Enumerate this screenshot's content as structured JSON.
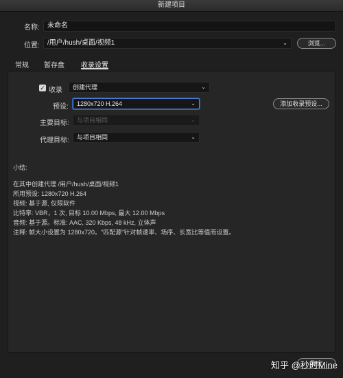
{
  "window": {
    "title": "新建项目"
  },
  "name": {
    "label": "名称:",
    "value": "未命名"
  },
  "location": {
    "label": "位置:",
    "value": "/用户/hush/桌面/视频1",
    "browse_label": "浏览..."
  },
  "tabs": [
    {
      "label": "常规"
    },
    {
      "label": "暂存盘"
    },
    {
      "label": "收录设置"
    }
  ],
  "ingest": {
    "checkbox_label": "收录",
    "mode_value": "创建代理",
    "preset_label": "预设:",
    "preset_value": "1280x720 H.264",
    "add_preset_label": "添加收录预设...",
    "primary_target_label": "主要目标:",
    "primary_target_value": "与项目相同",
    "proxy_target_label": "代理目标:",
    "proxy_target_value": "与项目相同"
  },
  "summary": {
    "title": "小结:",
    "lines": [
      "在其中创建代理 /用户/hush/桌面/视频1",
      "所用预设: 1280x720 H.264",
      "视频: 基于源, 仅限软件",
      "比特率: VBR，1 次, 目标 10.00 Mbps, 最大 12.00 Mbps",
      "音频: 基于源。标准: AAC, 320 Kbps, 48  kHz, 立体声",
      "注释: 帧大小设置为 1280x720。\"匹配源\"针对帧速率、场序、长宽比等值而设置。"
    ]
  },
  "footer": {
    "partial_button": "确定",
    "watermark": "知乎 @秒时Mine"
  },
  "icons": {
    "chevron": "chevron-down-icon",
    "check": "checkmark-icon"
  },
  "colors": {
    "background": "#1f1f1f",
    "panel": "#262626",
    "focus": "#4d7fd6"
  }
}
